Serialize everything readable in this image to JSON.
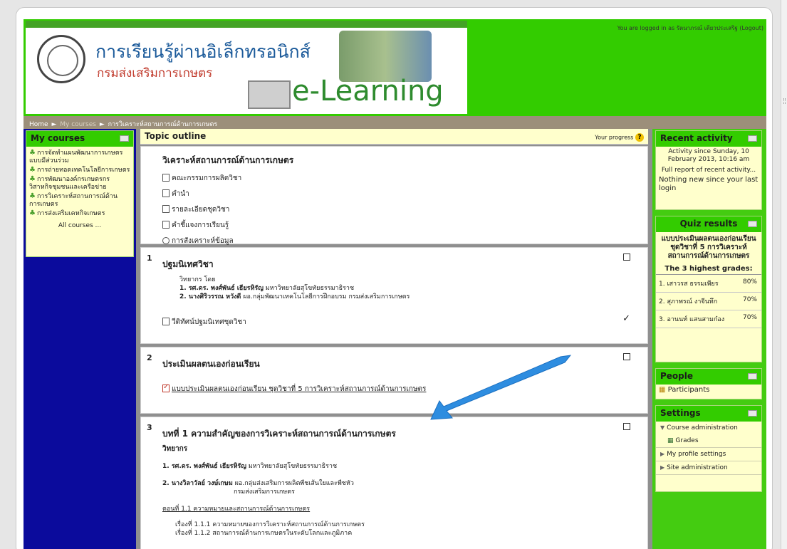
{
  "header": {
    "title": "การเรียนรู้ผ่านอิเล็กทรอนิกส์",
    "subtitle": "กรมส่งเสริมการเกษตร",
    "brand": "e-Learning",
    "login_text": "You are logged in as รัตนาภรณ์ เตียวประเสริฐ (Logout)"
  },
  "breadcrumb": {
    "home": "Home",
    "my_courses": "My courses",
    "current": "การวิเคราะห์สถานการณ์ด้านการเกษตร"
  },
  "my_courses": {
    "title": "My courses",
    "items": [
      "การจัดทำแผนพัฒนาการเกษตรแบบมีส่วนร่วม",
      "การถ่ายทอดเทคโนโลยีการเกษตร",
      "การพัฒนาองค์กรเกษตรกร วิสาหกิจชุมชนและเครือข่าย",
      "การวิเคราะห์สถานการณ์ด้านการเกษตร",
      "การส่งเสริมเคหกิจเกษตร"
    ],
    "all_courses": "All courses ..."
  },
  "topic": {
    "title": "Topic outline",
    "progress_label": "Your progress",
    "help_glyph": "?"
  },
  "section0": {
    "title": "วิเคราะห์สถานการณ์ด้านการเกษตร",
    "items": [
      "คณะกรรมการผลิตวิชา",
      "คำนำ",
      "รายละเอียดชุดวิชา",
      "คำชี้แจงการเรียนรู้",
      "การสังเคราะห์ข้อมูล"
    ]
  },
  "section1": {
    "num": "1",
    "title": "ปฐมนิเทศวิชา",
    "by": "วิทยากร โดย",
    "line1_name": "1. รศ.ดร. พงศ์พันธ์ เธียรหิรัญ",
    "line1_org": " มหาวิทยาลัยสุโขทัยธรรมาธิราช",
    "line2_name": "2. นางศิริวรรณ หวังดี",
    "line2_org": " ผอ.กลุ่มพัฒนาเทคโนโลยีการฝึกอบรม กรมส่งเสริมการเกษตร",
    "resource": "วีดิทัศน์ปฐมนิเทศชุดวิชา",
    "check": "✓"
  },
  "section2": {
    "num": "2",
    "title": "ประเมินผลตนเองก่อนเรียน",
    "quiz_link": "แบบประเมินผลตนเองก่อนเรียน ชุดวิชาที่ 5 การวิเคราะห์สถานการณ์ด้านการเกษตร"
  },
  "section3": {
    "num": "3",
    "title": "บทที่ 1 ความสำคัญของการวิเคราะห์สถานการณ์ด้านการเกษตร",
    "speaker_label": "วิทยากร",
    "line1_name": "1. รศ.ดร. พงศ์พันธ์ เธียรหิรัญ",
    "line1_org": " มหาวิทยาลัยสุโขทัยธรรมาธิราช",
    "line2_name": "2. นางวิลาวัลย์ วงษ์เกษม",
    "line2_org": " ผอ.กลุ่มส่งเสริมการผลิตพืชเส้นใยและพืชหัว",
    "line2_org2": "กรมส่งเสริมการเกษตร",
    "part_title": "ตอนที่ 1.1 ความหมายและสถานการณ์ด้านการเกษตร",
    "topic1": "เรื่องที่ 1.1.1 ความหมายของการวิเคราะห์สถานการณ์ด้านการเกษตร",
    "topic2": "เรื่องที่ 1.1.2 สถานการณ์ด้านการเกษตรในระดับโลกและภูมิภาค"
  },
  "recent_activity": {
    "title": "Recent activity",
    "since": "Activity since Sunday, 10 February 2013, 10:16 am",
    "full_report": "Full report of recent activity...",
    "nothing_new": "Nothing new since your last login"
  },
  "quiz_results": {
    "title": "Quiz results",
    "quiz_name": "แบบประเมินผลตนเองก่อนเรียน ชุดวิชาที่ 5 การวิเคราะห์สถานการณ์ด้านการเกษตร",
    "highest_label": "The 3 highest grades:",
    "grades": [
      {
        "rank": "1.",
        "name": "เสาวรส ธรรมเพียร",
        "pct": "80%"
      },
      {
        "rank": "2.",
        "name": "สุภาพรณ์ งาจีนทึก",
        "pct": "70%"
      },
      {
        "rank": "3.",
        "name": "อานนท์ แสนสามก๋อง",
        "pct": "70%"
      }
    ]
  },
  "people": {
    "title": "People",
    "participants": "Participants"
  },
  "settings": {
    "title": "Settings",
    "course_admin": "Course administration",
    "grades": "Grades",
    "profile": "My profile settings",
    "site_admin": "Site administration"
  },
  "colors": {
    "header_green": "#33cc00",
    "left_column": "#0b0b9c",
    "right_column": "#44cc11",
    "block_bg": "#ffffcc",
    "arrow_blue": "#2e8de0"
  }
}
